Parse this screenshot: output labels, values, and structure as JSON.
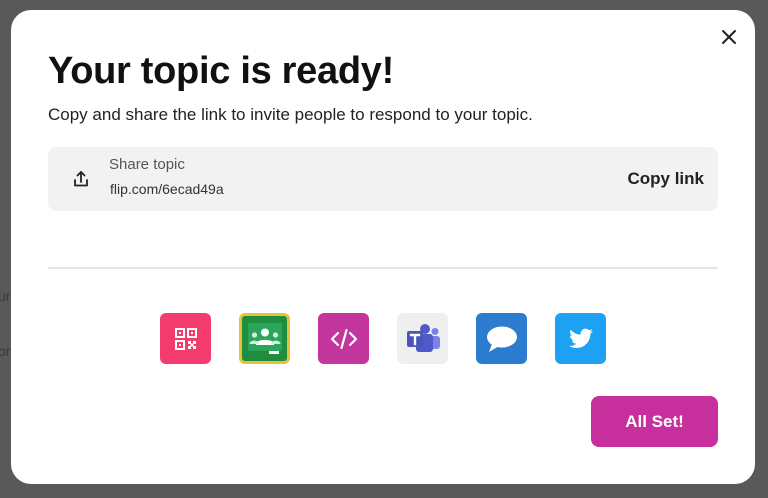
{
  "backdrop": {
    "fragments": [
      "ur",
      "or"
    ]
  },
  "modal": {
    "title": "Your topic is ready!",
    "subtitle": "Copy and share the link to invite people to respond to your topic.",
    "close_icon": "close-icon",
    "share": {
      "label": "Share topic",
      "url": "flip.com/6ecad49a",
      "icon": "share-upload-icon",
      "copy_label": "Copy link"
    },
    "share_targets": [
      {
        "name": "qr-code",
        "icon": "qr-code-icon",
        "color": "#f43b6d"
      },
      {
        "name": "google-classroom",
        "icon": "google-classroom-icon",
        "color": "#1e8e3e"
      },
      {
        "name": "embed",
        "icon": "embed-code-icon",
        "color": "#c2369d"
      },
      {
        "name": "microsoft-teams",
        "icon": "microsoft-teams-icon",
        "color": "#efefef"
      },
      {
        "name": "remind",
        "icon": "remind-chat-icon",
        "color": "#2b7bce"
      },
      {
        "name": "twitter",
        "icon": "twitter-icon",
        "color": "#1da1f2"
      }
    ],
    "done_label": "All Set!"
  },
  "colors": {
    "accent": "#c72f9c",
    "backdrop": "#595959",
    "surface": "#ffffff",
    "share_box": "#f2f2f2"
  }
}
